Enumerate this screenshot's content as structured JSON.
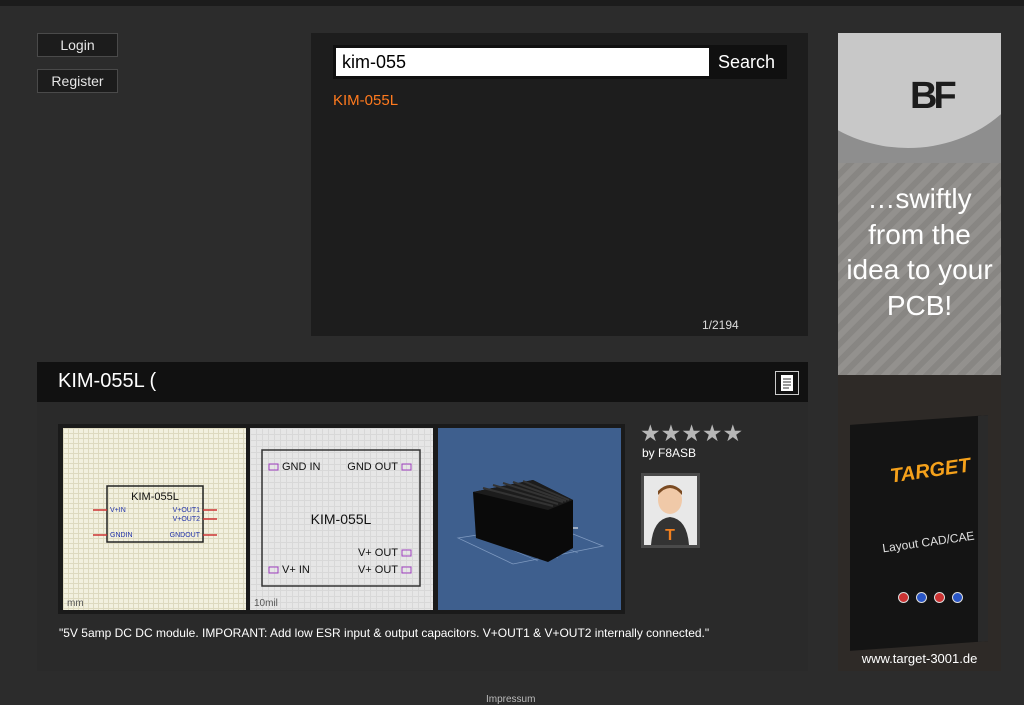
{
  "auth": {
    "login_label": "Login",
    "register_label": "Register"
  },
  "search": {
    "query": "kim-055",
    "button_label": "Search",
    "results": [
      "KIM-055L"
    ],
    "count_text": "1/2194"
  },
  "ad": {
    "logo_text": "BF",
    "tagline": "…swiftly from the idea to your PCB!",
    "brand": "TARGET",
    "product": "Layout CAD/CAE",
    "url": "www.target-3001.de"
  },
  "detail": {
    "title": "KIM-055L (",
    "schematic": {
      "part_name": "KIM-055L",
      "pins_left": [
        "V+IN",
        "GNDIN"
      ],
      "pins_right": [
        "V+OUT1",
        "V+OUT2",
        "GNDOUT"
      ],
      "unit": "mm"
    },
    "pcb": {
      "part_name": "KIM-055L",
      "pins_top": [
        "GND IN",
        "GND OUT"
      ],
      "pins_bottom_right": [
        "V+ OUT",
        "V+ OUT"
      ],
      "pin_bottom_left": "V+ IN",
      "unit": "10mil"
    },
    "rating": {
      "stars_filled": 0,
      "stars_total": 5
    },
    "author": "by F8ASB",
    "description": "\"5V 5amp DC DC module. IMPORANT: Add low ESR input & output capacitors. V+OUT1 & V+OUT2 internally connected.\""
  },
  "footer": {
    "imprint_label": "Impressum"
  }
}
